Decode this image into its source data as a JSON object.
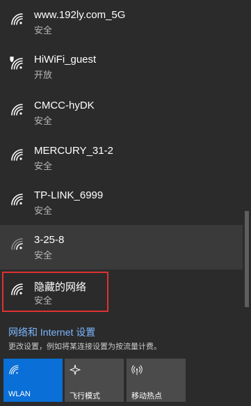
{
  "networks": [
    {
      "name": "www.192ly.com_5G",
      "status": "安全",
      "icon": "wifi-icon"
    },
    {
      "name": "HiWiFi_guest",
      "status": "开放",
      "icon": "wifi-shield-icon"
    },
    {
      "name": "CMCC-hyDK",
      "status": "安全",
      "icon": "wifi-icon"
    },
    {
      "name": "MERCURY_31-2",
      "status": "安全",
      "icon": "wifi-icon"
    },
    {
      "name": "TP-LINK_6999",
      "status": "安全",
      "icon": "wifi-icon"
    },
    {
      "name": "3-25-8",
      "status": "安全",
      "icon": "wifi-icon"
    },
    {
      "name": "隐藏的网络",
      "status": "安全",
      "icon": "wifi-icon"
    }
  ],
  "settings": {
    "link": "网络和 Internet 设置",
    "description": "更改设置，例如将某连接设置为按流量计费。"
  },
  "quick_actions": [
    {
      "label": "WLAN",
      "icon": "wifi-icon",
      "active": true
    },
    {
      "label": "飞行模式",
      "icon": "airplane-icon",
      "active": false
    },
    {
      "label": "移动热点",
      "icon": "hotspot-icon",
      "active": false
    }
  ],
  "colors": {
    "background": "#2b2b2b",
    "link": "#7cb7ff",
    "active_tile": "#0a6fd6",
    "tile": "#4b4b4b",
    "highlight_box": "#e03232"
  }
}
